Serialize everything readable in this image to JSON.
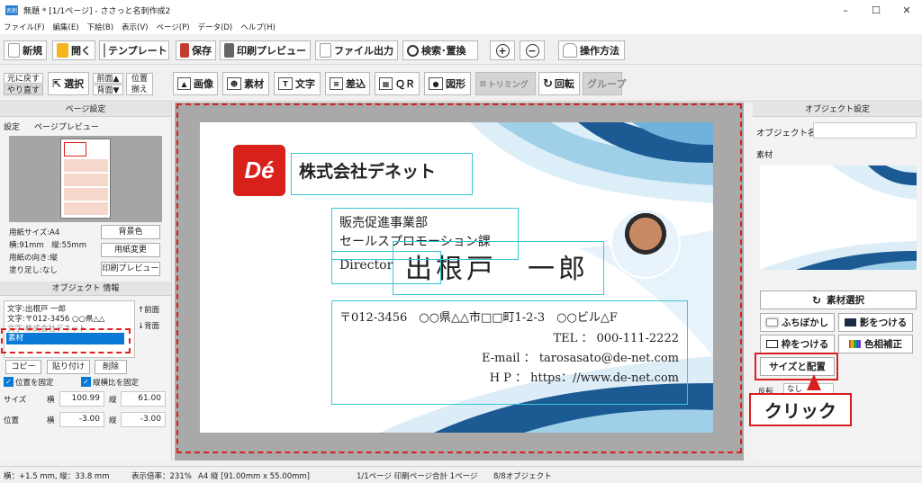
{
  "window": {
    "title": "無題 * [1/1ページ] - ささっと名刺作成2",
    "minimize": "–",
    "maximize": "☐",
    "close": "✕"
  },
  "menu": [
    "ファイル(F)",
    "編集(E)",
    "下絵(B)",
    "表示(V)",
    "ページ(P)",
    "データ(D)",
    "ヘルプ(H)"
  ],
  "toolbar": {
    "new": "新規",
    "open": "開く",
    "template": "テンプレート",
    "save": "保存",
    "print_preview": "印刷プレビュー",
    "file_output": "ファイル出力",
    "search_replace": "検索･置換",
    "zoom_in": "+",
    "zoom_out": "−",
    "help": "操作方法"
  },
  "toolbar2": {
    "undo": "元に戻す",
    "redo": "やり直す",
    "select": "選択",
    "front": "前面▲",
    "back": "背面▼",
    "align1": "位置",
    "align2": "揃え",
    "image": "画像",
    "material": "素材",
    "text": "文字",
    "merge": "差込",
    "qr": "ＱＲ",
    "shape": "図形",
    "trim": "トリミング",
    "rotate": "回転",
    "group": "グループ"
  },
  "page_settings": {
    "header": "ページ設定",
    "tab_settings": "設定",
    "tab_preview": "ページプレビュー",
    "paper_size": "用紙サイズ:A4",
    "dims": "横:91mm　縦:55mm",
    "orientation": "用紙の向き:縦",
    "bleed": "塗り足し:なし",
    "bg_color": "背景色",
    "change_paper": "用紙変更",
    "print_preview": "印刷プレビュー"
  },
  "object_info": {
    "header": "オブジェクト 情報",
    "items": [
      "文字:出根戸 一郎",
      "文字:〒012-3456 ○○県△△",
      "文字:株式会社デネット",
      "素材"
    ],
    "selected_index": 3,
    "front": "↑前面",
    "back": "↓背面",
    "copy": "コピー",
    "paste": "貼り付け",
    "delete": "削除",
    "fix_pos": "位置を固定",
    "fix_ratio": "縦横比を固定",
    "fix_pos_checked": true,
    "fix_ratio_checked": true,
    "size_label": "サイズ",
    "pos_label": "位置",
    "w_label": "横",
    "h_label": "縦",
    "size_w": "100.99",
    "size_h": "61.00",
    "pos_x": "-3.00",
    "pos_y": "-3.00"
  },
  "card": {
    "logo": "Dé",
    "company": "株式会社デネット",
    "dept1": "販売促進事業部",
    "dept2": "セールスプロモーション課",
    "title": "Director",
    "name": "出根戸　一郎",
    "address": "〒012-3456　○○県△△市□□町1-2-3　○○ビル△F",
    "tel": "TEL ： 000-111-2222",
    "email": "E-mail ： tarosasato@de-net.com",
    "hp": "H P ： https：//www.de-net.com"
  },
  "object_settings": {
    "header": "オブジェクト設定",
    "name_label": "オブジェクト名",
    "name_value": "",
    "tab": "素材",
    "select_material": "素材選択",
    "blur": "ふちぼかし",
    "shadow": "影をつける",
    "frame": "枠をつける",
    "color_correct": "色相補正",
    "size_layout": "サイズと配置",
    "rotate_label": "反転",
    "rotate_value": "なし"
  },
  "annotation": {
    "click": "クリック"
  },
  "status": {
    "coords": "横：+1.5 mm, 縦：33.8 mm",
    "zoom": "表示倍率：231%",
    "paper": "A4 縦 [91.00mm x 55.00mm]",
    "pages": "1/1ページ 印刷ページ合計 1ページ",
    "objects": "8/8オブジェクト"
  },
  "colors": {
    "accent_red": "#d9211c",
    "selection_cyan": "#35c8d6",
    "selected_row": "#0a78d7",
    "wave_dark": "#1c5a94",
    "wave_light": "#9fd0e8"
  }
}
